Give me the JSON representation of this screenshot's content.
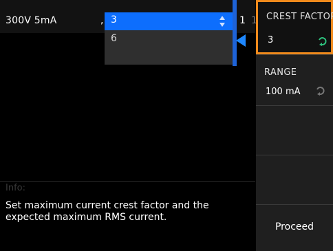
{
  "status_bar": {
    "range_label": "300V 5mA",
    "comma": ",",
    "right_number": "1",
    "right_number_2": "1"
  },
  "dropdown": {
    "selected": "3",
    "options": [
      "3",
      "6"
    ]
  },
  "info": {
    "title": "Info:",
    "text": "Set maximum current crest factor and the expected maximum RMS current."
  },
  "softkeys": [
    {
      "title": "CREST FACTOR",
      "value": "3",
      "active": true,
      "accent": "#f08a1c",
      "knob_color": "#2ec27e"
    },
    {
      "title": "RANGE",
      "value": "100 mA",
      "knob_color": "#777777"
    },
    {
      "title": "",
      "value": ""
    },
    {
      "title": "",
      "value": ""
    },
    {
      "title": "Proceed",
      "value": ""
    }
  ],
  "colors": {
    "selection_blue": "#0d6efd",
    "accent_orange": "#f08a1c",
    "knob_green": "#2ec27e"
  },
  "icons": [
    "updown-arrows-icon",
    "pointer-triangle-icon",
    "rotary-knob-icon"
  ]
}
